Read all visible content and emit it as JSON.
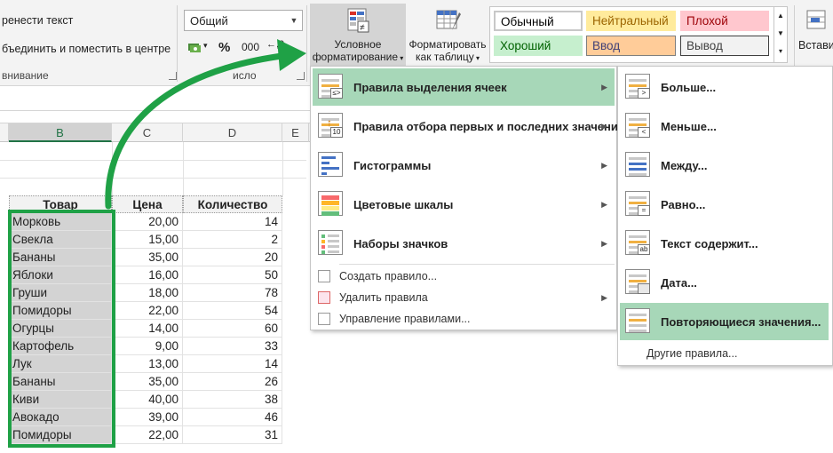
{
  "ribbon": {
    "wrap_text": "ренести текст",
    "merge_center": "бъединить и поместить в центре",
    "alignment_group": "внивание",
    "number_format": "Общий",
    "percent": "%",
    "thousands": "000",
    "number_group": "исло",
    "conditional_formatting": "Условное",
    "conditional_formatting_2": "форматирование",
    "format_as_table": "Форматировать",
    "format_as_table_2": "как таблицу",
    "insert": "Встави",
    "styles": [
      {
        "label": "Обычный",
        "bg": "#ffffff",
        "fg": "#000000",
        "border": "#c0c0c0"
      },
      {
        "label": "Нейтральный",
        "bg": "#ffeb9c",
        "fg": "#9c6500",
        "border": "#ffeb9c"
      },
      {
        "label": "Плохой",
        "bg": "#ffc7ce",
        "fg": "#9c0006",
        "border": "#ffc7ce"
      },
      {
        "label": "Хороший",
        "bg": "#c6efce",
        "fg": "#006100",
        "border": "#c6efce"
      },
      {
        "label": "Ввод",
        "bg": "#ffcc99",
        "fg": "#3f3f76",
        "border": "#7f7f7f"
      },
      {
        "label": "Вывод",
        "bg": "#f2f2f2",
        "fg": "#3f3f3f",
        "border": "#3f3f3f"
      }
    ]
  },
  "columns": [
    "B",
    "C",
    "D",
    "E"
  ],
  "table": {
    "headers": [
      "Товар",
      "Цена",
      "Количество"
    ],
    "rows": [
      [
        "Морковь",
        "20,00",
        "14"
      ],
      [
        "Свекла",
        "15,00",
        "2"
      ],
      [
        "Бананы",
        "35,00",
        "20"
      ],
      [
        "Яблоки",
        "16,00",
        "50"
      ],
      [
        "Груши",
        "18,00",
        "78"
      ],
      [
        "Помидоры",
        "22,00",
        "54"
      ],
      [
        "Огурцы",
        "14,00",
        "60"
      ],
      [
        "Картофель",
        "9,00",
        "33"
      ],
      [
        "Лук",
        "13,00",
        "14"
      ],
      [
        "Бананы",
        "35,00",
        "26"
      ],
      [
        "Киви",
        "40,00",
        "38"
      ],
      [
        "Авокадо",
        "39,00",
        "46"
      ],
      [
        "Помидоры",
        "22,00",
        "31"
      ]
    ]
  },
  "menu": {
    "items": [
      {
        "label": "Правила выделения ячеек",
        "icon": "highlight-rules-icon"
      },
      {
        "label": "Правила отбора первых и последних значений",
        "icon": "top-bottom-rules-icon"
      },
      {
        "label": "Гистограммы",
        "icon": "data-bars-icon"
      },
      {
        "label": "Цветовые шкалы",
        "icon": "color-scales-icon"
      },
      {
        "label": "Наборы значков",
        "icon": "icon-sets-icon"
      }
    ],
    "small_items": [
      {
        "label": "Создать правило..."
      },
      {
        "label": "Удалить правила"
      },
      {
        "label": "Управление правилами..."
      }
    ]
  },
  "submenu": {
    "items": [
      {
        "label": "Больше...",
        "badge": ">"
      },
      {
        "label": "Меньше...",
        "badge": "<"
      },
      {
        "label": "Между...",
        "badge": ""
      },
      {
        "label": "Равно...",
        "badge": "="
      },
      {
        "label": "Текст содержит...",
        "badge": "ab"
      },
      {
        "label": "Дата...",
        "badge": ""
      },
      {
        "label": "Повторяющиеся значения...",
        "badge": ""
      }
    ],
    "more_rules": "Другие правила...",
    "icon_badges": {
      "ten": "10",
      "le": "≤>"
    }
  },
  "colors": {
    "accent_green": "#1fa146",
    "highlight": "#a7d7b8",
    "excel_green": "#217346"
  }
}
